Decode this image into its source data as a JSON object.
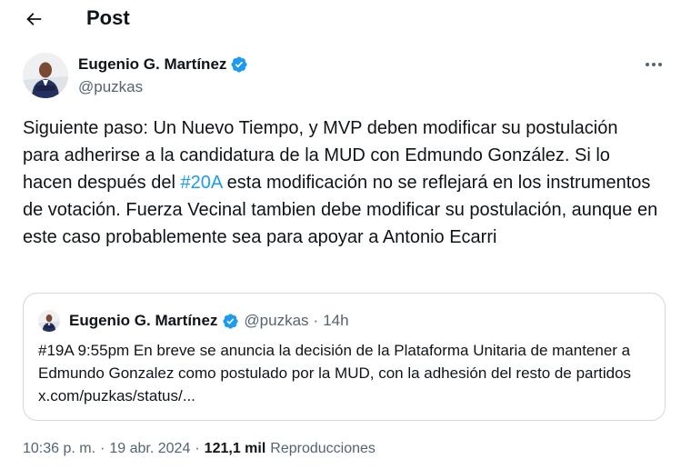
{
  "header": {
    "back_icon": "arrow-left-icon",
    "title": "Post"
  },
  "author": {
    "name": "Eugenio G. Martínez",
    "handle": "@puzkas",
    "verified": true,
    "verified_color": "#1d9bf0",
    "more_icon": "more-horizontal-icon"
  },
  "tweet": {
    "text_part1": "Siguiente paso: Un Nuevo Tiempo, y MVP deben modificar su postulación para adherirse a la candidatura de la MUD con Edmundo González. Si lo hacen después del ",
    "hashtag": "#20A",
    "text_part2": " esta modificación no se reflejará en los instrumentos de votación. Fuerza Vecinal tambien debe modificar su postulación, aunque en este caso probablemente sea para apoyar a Antonio Ecarri",
    "hashtag_color": "#1d9bf0"
  },
  "quote": {
    "name": "Eugenio G. Martínez",
    "handle": "@puzkas",
    "dot": "·",
    "time": "14h",
    "text": "#19A 9:55pm En breve se anuncia la decisión de la Plataforma Unitaria de mantener a Edmundo Gonzalez como postulado por la MUD, con la adhesión del resto de partidos x.com/puzkas/status/..."
  },
  "meta": {
    "time": "10:36 p. m.",
    "sep1": "·",
    "date": "19 abr. 2024",
    "sep2": "·",
    "views_count": "121,1 mil",
    "views_label": "Reproducciones"
  }
}
